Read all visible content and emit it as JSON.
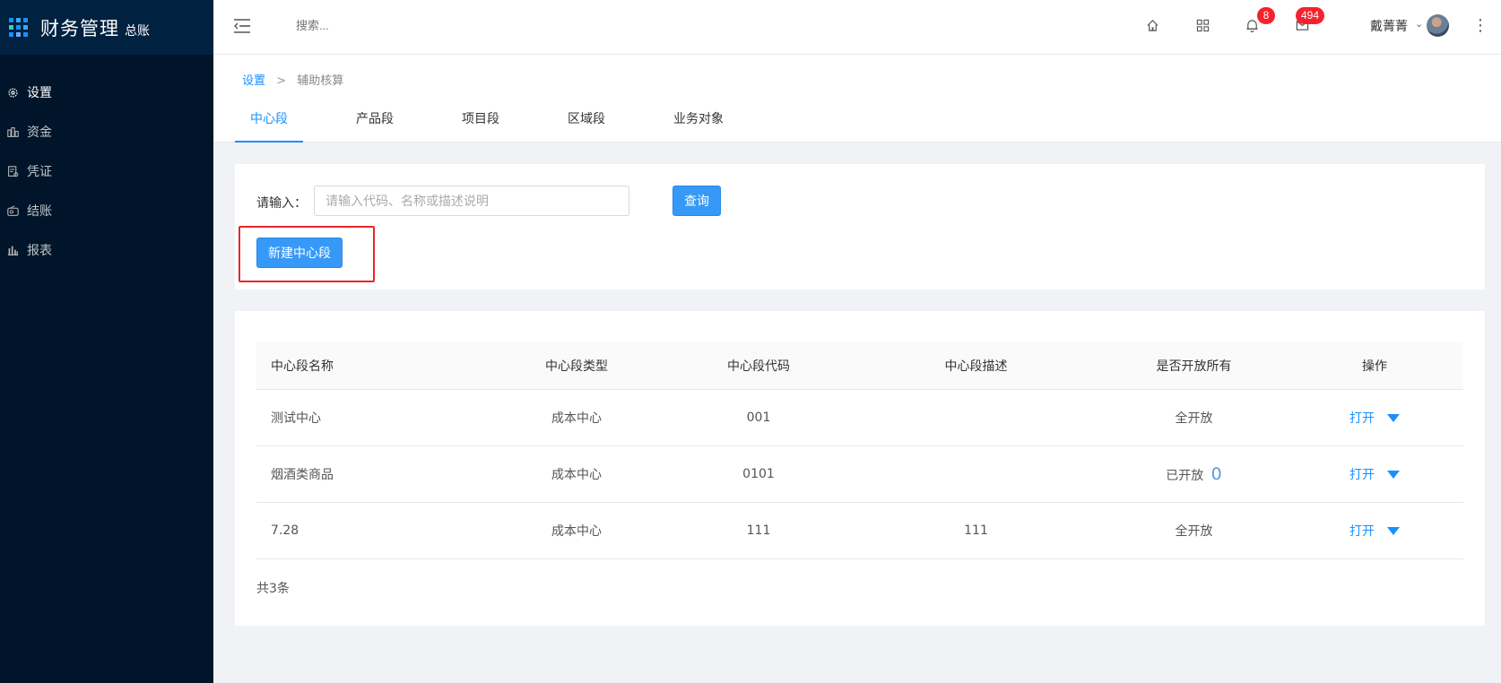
{
  "app": {
    "title": "财务管理",
    "subtitle": "总账"
  },
  "sidebar": {
    "items": [
      {
        "label": "设置",
        "icon": "gear-icon"
      },
      {
        "label": "资金",
        "icon": "funds-icon"
      },
      {
        "label": "凭证",
        "icon": "voucher-icon"
      },
      {
        "label": "结账",
        "icon": "checkout-icon"
      },
      {
        "label": "报表",
        "icon": "chart-icon"
      }
    ],
    "active": "设置"
  },
  "header": {
    "search_placeholder": "搜索...",
    "notifications_count": "8",
    "messages_count": "494",
    "user_name": "戴菁菁"
  },
  "breadcrumb": {
    "root": "设置",
    "separator": ">",
    "current": "辅助核算"
  },
  "tabs": [
    "中心段",
    "产品段",
    "项目段",
    "区域段",
    "业务对象"
  ],
  "query": {
    "label": "请输入：",
    "placeholder": "请输入代码、名称或描述说明",
    "value": "",
    "button": "查询",
    "new_button": "新建中心段"
  },
  "table": {
    "columns": [
      "中心段名称",
      "中心段类型",
      "中心段代码",
      "中心段描述",
      "是否开放所有",
      "操作"
    ],
    "rows": [
      {
        "name": "测试中心",
        "type": "成本中心",
        "code": "001",
        "desc": "",
        "open": "全开放",
        "open_count": "",
        "action": "打开"
      },
      {
        "name": "烟酒类商品",
        "type": "成本中心",
        "code": "0101",
        "desc": "",
        "open": "已开放",
        "open_count": "0",
        "action": "打开"
      },
      {
        "name": "7.28",
        "type": "成本中心",
        "code": "111",
        "desc": "111",
        "open": "全开放",
        "open_count": "",
        "action": "打开"
      }
    ],
    "total": "共3条"
  },
  "colors": {
    "sidebar_bg": "#001529",
    "accent": "#1890ff",
    "badge": "#f5222d",
    "highlight": "#e8262c"
  }
}
